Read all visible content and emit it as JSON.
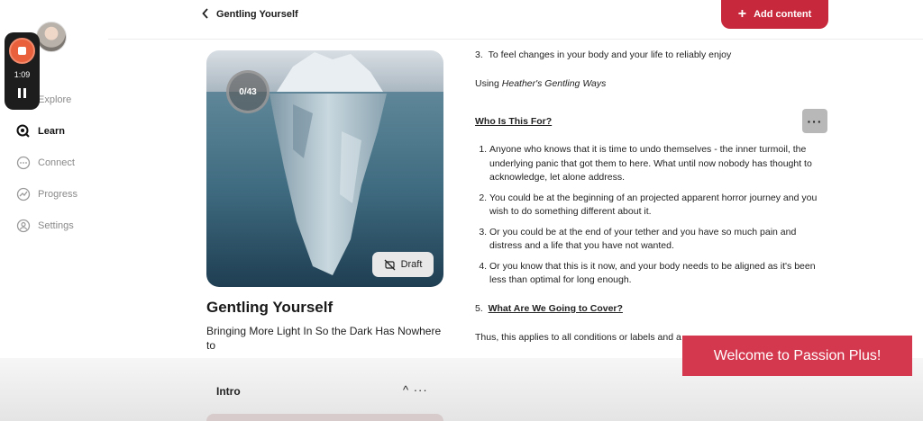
{
  "sidebar": {
    "recorder": {
      "time": "1:09"
    },
    "items": [
      {
        "label": "Explore",
        "icon": "compass-icon",
        "active": false
      },
      {
        "label": "Learn",
        "icon": "learn-icon",
        "active": true
      },
      {
        "label": "Connect",
        "icon": "chat-icon",
        "active": false
      },
      {
        "label": "Progress",
        "icon": "progress-icon",
        "active": false
      },
      {
        "label": "Settings",
        "icon": "user-icon",
        "active": false
      }
    ]
  },
  "header": {
    "back_label": "Gentling Yourself",
    "add_content_label": "Add content",
    "accent": "#c8283c"
  },
  "course": {
    "progress_text": "0/43",
    "draft_label": "Draft",
    "title": "Gentling Yourself",
    "subtitle": "Bringing More Light In So the Dark Has Nowhere to"
  },
  "content": {
    "item3": "To feel changes in your body and your life to reliably enjoy",
    "using_prefix": "Using ",
    "using_emph": "Heather's Gentling Ways",
    "who_heading": "Who Is This For?",
    "list": [
      "Anyone who knows that it is time to undo themselves - the inner turmoil, the underlying panic that got them to here. What until now nobody has thought to acknowledge, let alone address.",
      "You could be at the beginning of an projected apparent horror journey and you wish to do something different about it.",
      "Or you could be at the end of your tether and you have so much pain and distress and a life that you have not wanted.",
      "Or you know that this is it now, and your body needs to be aligned as it's been less than optimal for long enough."
    ],
    "cover_heading": "What Are We Going to Cover?",
    "thus_text": "Thus, this applies to all conditions or labels and a"
  },
  "welcome_banner": "Welcome to Passion Plus!",
  "intro": {
    "label": "Intro",
    "controls": "^ ···"
  }
}
